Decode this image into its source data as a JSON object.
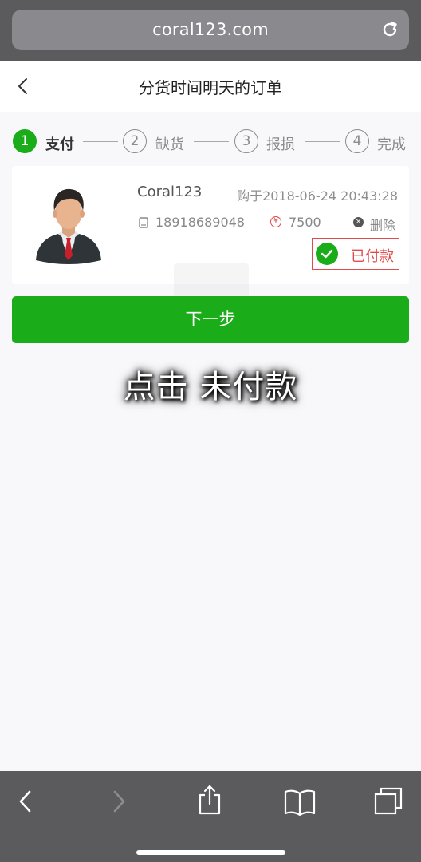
{
  "browser": {
    "url": "coral123.com",
    "reload_icon": "reload-icon"
  },
  "page": {
    "title": "分货时间明天的订单",
    "back_icon": "chevron-left-icon"
  },
  "steps": [
    {
      "number": "1",
      "label": "支付",
      "active": true
    },
    {
      "number": "2",
      "label": "缺货",
      "active": false
    },
    {
      "number": "3",
      "label": "报损",
      "active": false
    },
    {
      "number": "4",
      "label": "完成",
      "active": false
    }
  ],
  "order": {
    "username": "Coral123",
    "purchase_time": "购于2018-06-24 20:43:28",
    "phone": "18918689048",
    "amount_symbol": "¥",
    "amount": "7500",
    "delete_label": "删除",
    "delete_symbol": "×",
    "status_label": "已付款"
  },
  "next_button": "下一步",
  "caption": "点击 未付款",
  "colors": {
    "accent_green": "#1aad19",
    "status_red": "#e24b4b",
    "browser_chrome": "#5b5b5d"
  },
  "toolbar": {
    "icons": [
      "back-arrow-icon",
      "forward-arrow-icon",
      "share-icon",
      "bookmarks-icon",
      "tabs-icon"
    ]
  }
}
